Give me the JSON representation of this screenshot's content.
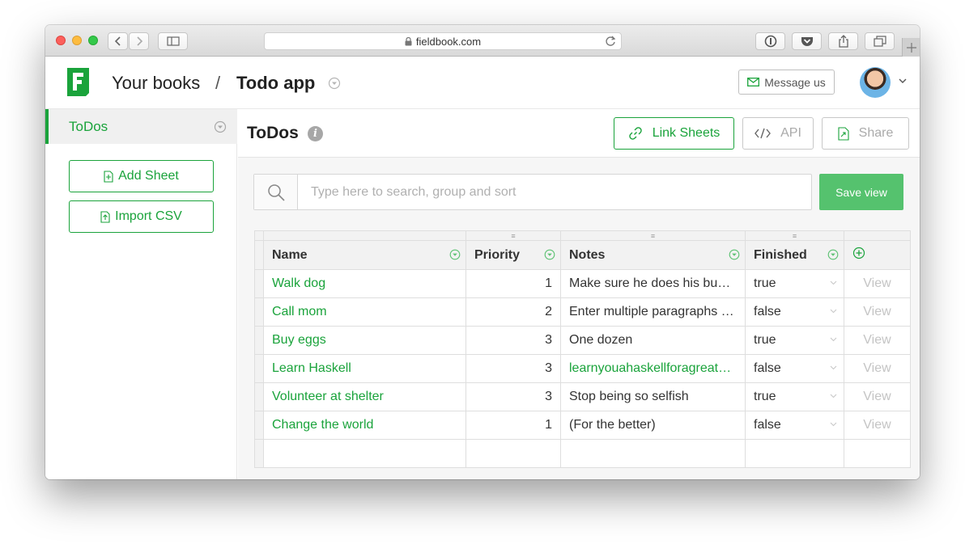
{
  "browser": {
    "url": "fieldbook.com"
  },
  "header": {
    "crumb_books": "Your books",
    "crumb_separator": "/",
    "crumb_app": "Todo app",
    "message_label": "Message us"
  },
  "sidebar": {
    "sheet_name": "ToDos",
    "add_sheet_label": "Add Sheet",
    "import_csv_label": "Import CSV"
  },
  "sheet": {
    "title": "ToDos",
    "info_glyph": "i",
    "link_sheets_label": "Link Sheets",
    "api_label": "API",
    "share_label": "Share",
    "search_placeholder": "Type here to search, group and sort",
    "save_view_label": "Save view"
  },
  "table": {
    "columns": [
      "Name",
      "Priority",
      "Notes",
      "Finished"
    ],
    "view_label": "View",
    "handle_glyph": "≡",
    "rows": [
      {
        "name": "Walk dog",
        "priority": "1",
        "notes": "Make sure he does his business",
        "finished": "true"
      },
      {
        "name": "Call mom",
        "priority": "2",
        "notes": "Enter multiple paragraphs here",
        "finished": "false"
      },
      {
        "name": "Buy eggs",
        "priority": "3",
        "notes": "One dozen",
        "finished": "true"
      },
      {
        "name": "Learn Haskell",
        "priority": "3",
        "notes": "learnyouahaskellforagreatgood.com",
        "finished": "false"
      },
      {
        "name": "Volunteer at shelter",
        "priority": "3",
        "notes": "Stop being so selfish",
        "finished": "true"
      },
      {
        "name": "Change the world",
        "priority": "1",
        "notes": "(For the better)",
        "finished": "false"
      }
    ]
  },
  "colors": {
    "brand_green": "#1aa33b",
    "save_green": "#55c26e"
  }
}
